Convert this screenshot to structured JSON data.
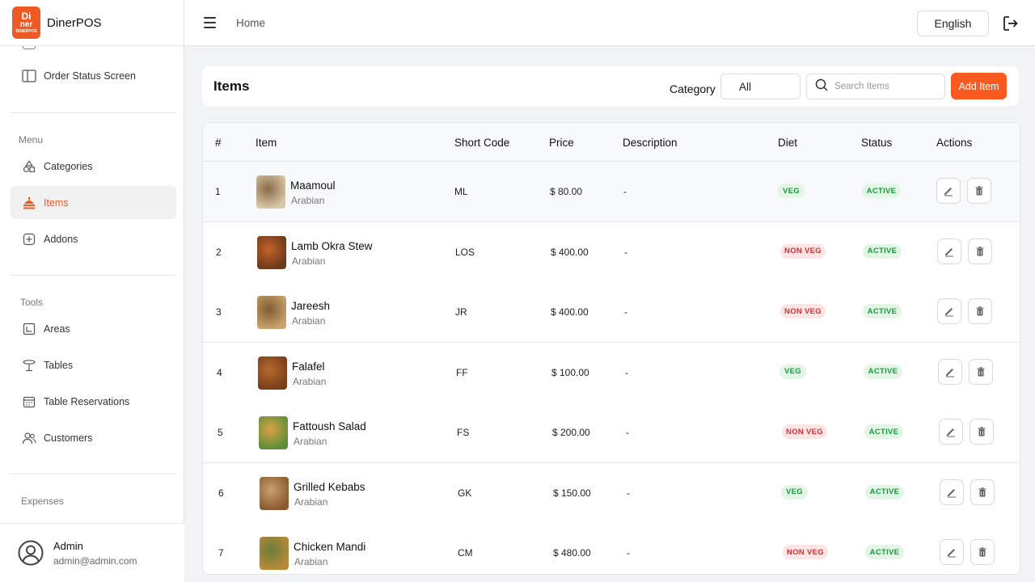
{
  "app": {
    "logo_line1": "Di",
    "logo_line2": "ner",
    "logo_line3": "DINERPOS",
    "name": "DinerPOS"
  },
  "sidebar": {
    "items_top": [
      {
        "label": "Order Status Screen",
        "icon": "layout-columns-icon"
      }
    ],
    "menu_section": "Menu",
    "menu_items": [
      {
        "label": "Categories",
        "icon": "shapes-icon"
      },
      {
        "label": "Items",
        "icon": "food-tray-icon",
        "active": true
      },
      {
        "label": "Addons",
        "icon": "plus-square-icon"
      }
    ],
    "tools_section": "Tools",
    "tools_items": [
      {
        "label": "Areas",
        "icon": "area-icon"
      },
      {
        "label": "Tables",
        "icon": "table-icon"
      },
      {
        "label": "Table Reservations",
        "icon": "calendar-icon"
      },
      {
        "label": "Customers",
        "icon": "users-icon"
      }
    ],
    "expenses_section": "Expenses",
    "user": {
      "name": "Admin",
      "email": "admin@admin.com"
    }
  },
  "topbar": {
    "breadcrumb": "Home",
    "language": "English"
  },
  "items_header": {
    "title": "Items",
    "category_label": "Category",
    "category_value": "All",
    "search_placeholder": "Search Items",
    "add_label": "Add Item"
  },
  "table": {
    "headers": [
      "#",
      "Item",
      "Short Code",
      "Price",
      "Description",
      "Diet",
      "Status",
      "Actions"
    ],
    "rows": [
      {
        "num": "1",
        "name": "Maamoul",
        "category": "Arabian",
        "code": "ML",
        "price": "$ 80.00",
        "description": "-",
        "diet": "VEG",
        "status": "ACTIVE"
      },
      {
        "num": "2",
        "name": "Lamb Okra Stew",
        "category": "Arabian",
        "code": "LOS",
        "price": "$ 400.00",
        "description": "-",
        "diet": "NON VEG",
        "status": "ACTIVE"
      },
      {
        "num": "3",
        "name": "Jareesh",
        "category": "Arabian",
        "code": "JR",
        "price": "$ 400.00",
        "description": "-",
        "diet": "NON VEG",
        "status": "ACTIVE"
      },
      {
        "num": "4",
        "name": "Falafel",
        "category": "Arabian",
        "code": "FF",
        "price": "$ 100.00",
        "description": "-",
        "diet": "VEG",
        "status": "ACTIVE"
      },
      {
        "num": "5",
        "name": "Fattoush Salad",
        "category": "Arabian",
        "code": "FS",
        "price": "$ 200.00",
        "description": "-",
        "diet": "NON VEG",
        "status": "ACTIVE"
      },
      {
        "num": "6",
        "name": "Grilled Kebabs",
        "category": "Arabian",
        "code": "GK",
        "price": "$ 150.00",
        "description": "-",
        "diet": "VEG",
        "status": "ACTIVE"
      },
      {
        "num": "7",
        "name": "Chicken Mandi",
        "category": "Arabian",
        "code": "CM",
        "price": "$ 480.00",
        "description": "-",
        "diet": "NON VEG",
        "status": "ACTIVE"
      }
    ]
  },
  "colors": {
    "accent": "#fa5a20",
    "veg": "#159a3a",
    "nonveg": "#d32f2f"
  }
}
